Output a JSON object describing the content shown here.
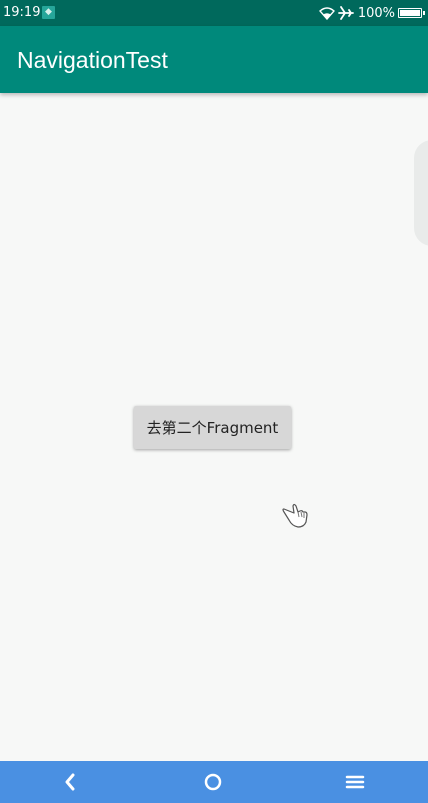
{
  "status_bar": {
    "time": "19:19",
    "notification_icon": "app-notification-icon",
    "battery_percent": "100%",
    "icons": [
      "wifi-icon",
      "airplane-mode-icon",
      "battery-icon"
    ]
  },
  "app_bar": {
    "title": "NavigationTest"
  },
  "main": {
    "button_label": "去第二个Fragment"
  },
  "nav_bar": {
    "buttons": [
      "back-icon",
      "home-icon",
      "menu-icon"
    ]
  },
  "colors": {
    "status_bar": "#00695c",
    "app_bar": "#00897b",
    "background": "#f7f8f7",
    "button": "#d7d7d7",
    "nav_bar": "#4a90e2"
  }
}
